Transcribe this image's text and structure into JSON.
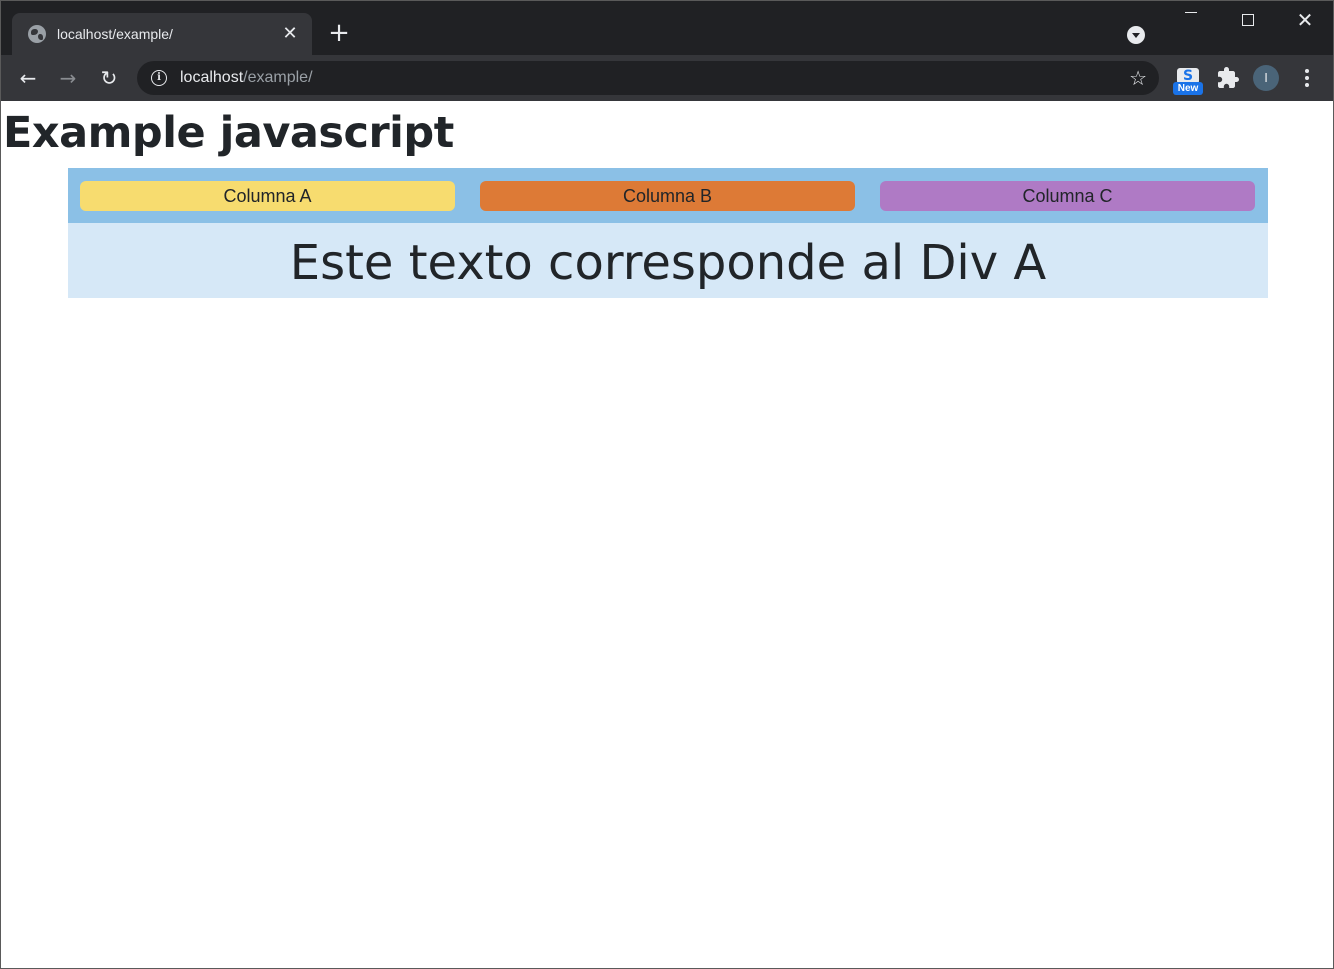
{
  "browser": {
    "tab": {
      "title": "localhost/example/",
      "close_label": "✕",
      "favicon_icon": "globe-icon"
    },
    "new_tab_label": "+",
    "nav": {
      "back_label": "←",
      "forward_label": "→",
      "reload_label": "↻"
    },
    "address": {
      "host": "localhost",
      "path": "/example/",
      "info_label": "i",
      "star_label": "☆"
    },
    "extensions": {
      "ext_s_letter": "S",
      "ext_s_badge": "New",
      "avatar_letter": "I"
    },
    "window_close_label": "✕"
  },
  "page": {
    "title": "Example javascript",
    "columns": [
      {
        "label": "Columna A",
        "color": "#f7dc6f"
      },
      {
        "label": "Columna B",
        "color": "#dd7a36"
      },
      {
        "label": "Columna C",
        "color": "#af7ac5"
      }
    ],
    "content_text": "Este texto corresponde al Div A",
    "colors": {
      "column_bar": "#8bc0e6",
      "content_panel": "#d6e8f7"
    }
  }
}
